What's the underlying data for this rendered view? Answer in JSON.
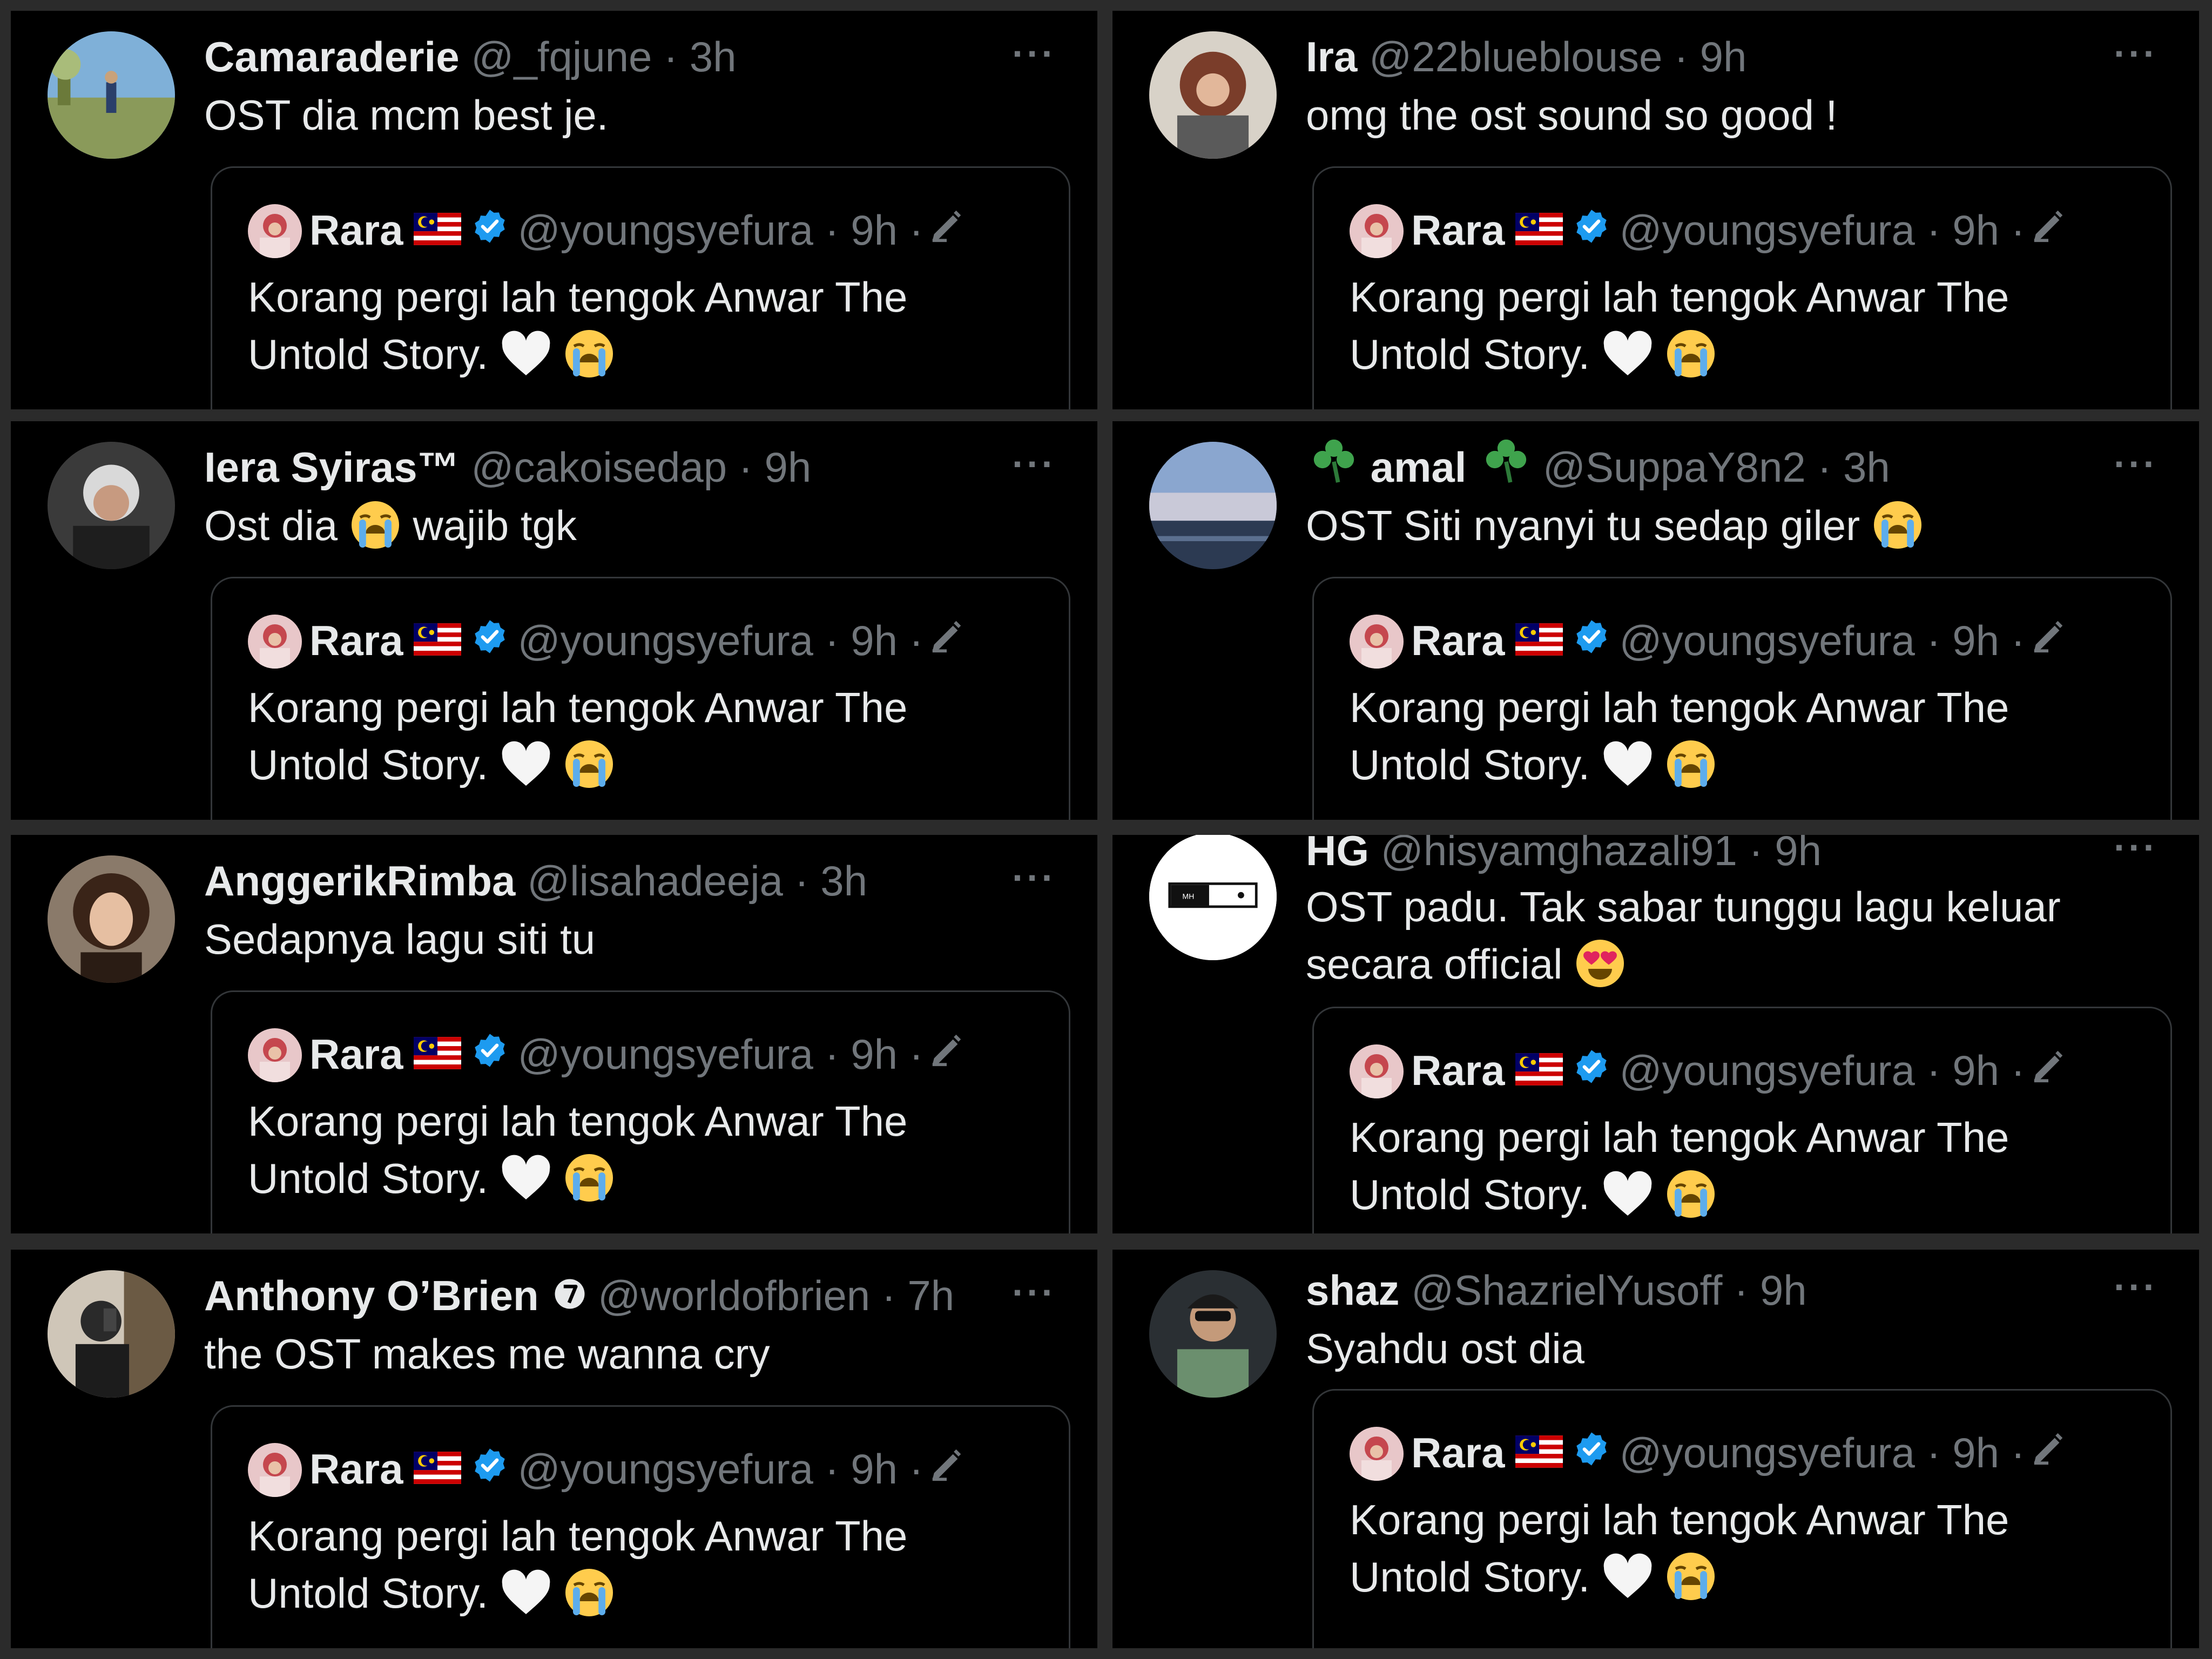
{
  "colors": {
    "background": "#000000",
    "separator": "#2b2b2b",
    "primary_text": "#e7e9ea",
    "secondary_text": "#71767b",
    "verified_blue": "#1d9bf0",
    "quote_border": "#333639"
  },
  "quoted_tweet": {
    "name": "Rara",
    "flag_icon": "malaysia-flag-icon",
    "verified_icon": "verified-badge-icon",
    "handle": "@youngsyefura",
    "dot": "·",
    "time": "9h",
    "edit_icon": "edit-pencil-icon",
    "text_line1": "Korang pergi lah tengok Anwar The",
    "text_line2": "Untold Story.",
    "emojis": [
      "white-heart-icon",
      "loudly-crying-face-icon"
    ]
  },
  "tweets": [
    {
      "name": "Camaraderie",
      "handle": "@_fqjune",
      "dot": "·",
      "time": "3h",
      "more": "···",
      "text": "OST dia mcm best je.",
      "avatar": "avatar-park"
    },
    {
      "name": "Ira",
      "handle": "@22blueblouse",
      "dot": "·",
      "time": "9h",
      "more": "···",
      "text": "omg the ost sound so good !",
      "avatar": "avatar-woman-curly"
    },
    {
      "name": "Iera Syiras™",
      "handle": "@cakoisedap",
      "dot": "·",
      "time": "9h",
      "more": "···",
      "text_before": "Ost dia",
      "text_after": "wajib tgk",
      "avatar": "avatar-selfie"
    },
    {
      "name": "amal",
      "name_prefix_icon": "shamrock-icon",
      "name_suffix_icon": "shamrock-icon",
      "handle": "@SuppaY8n2",
      "dot": "·",
      "time": "3h",
      "more": "···",
      "text": "OST Siti nyanyi tu sedap giler",
      "avatar": "avatar-sea"
    },
    {
      "name": "AnggerikRimba",
      "handle": "@lisahadeeja",
      "dot": "·",
      "time": "3h",
      "more": "···",
      "text": "Sedapnya lagu siti tu",
      "avatar": "avatar-portrait"
    },
    {
      "name": "HG",
      "handle": "@hisyamghazali91",
      "dot": "·",
      "time": "9h",
      "more": "···",
      "text_line1": "OST padu. Tak sabar tunggu lagu keluar",
      "text_line2": "secara official",
      "avatar": "avatar-logo-mh",
      "avatar_logo_text": "MH"
    },
    {
      "name": "Anthony O’Brien",
      "name_suffix_icon": "number-7-circle-icon",
      "handle": "@worldofbrien",
      "dot": "·",
      "time": "7h",
      "more": "···",
      "text": "the OST makes me wanna cry",
      "avatar": "avatar-mirror-selfie"
    },
    {
      "name": "shaz",
      "handle": "@ShazrielYusoff",
      "dot": "·",
      "time": "9h",
      "more": "···",
      "text": "Syahdu ost dia",
      "avatar": "avatar-car-selfie"
    }
  ]
}
